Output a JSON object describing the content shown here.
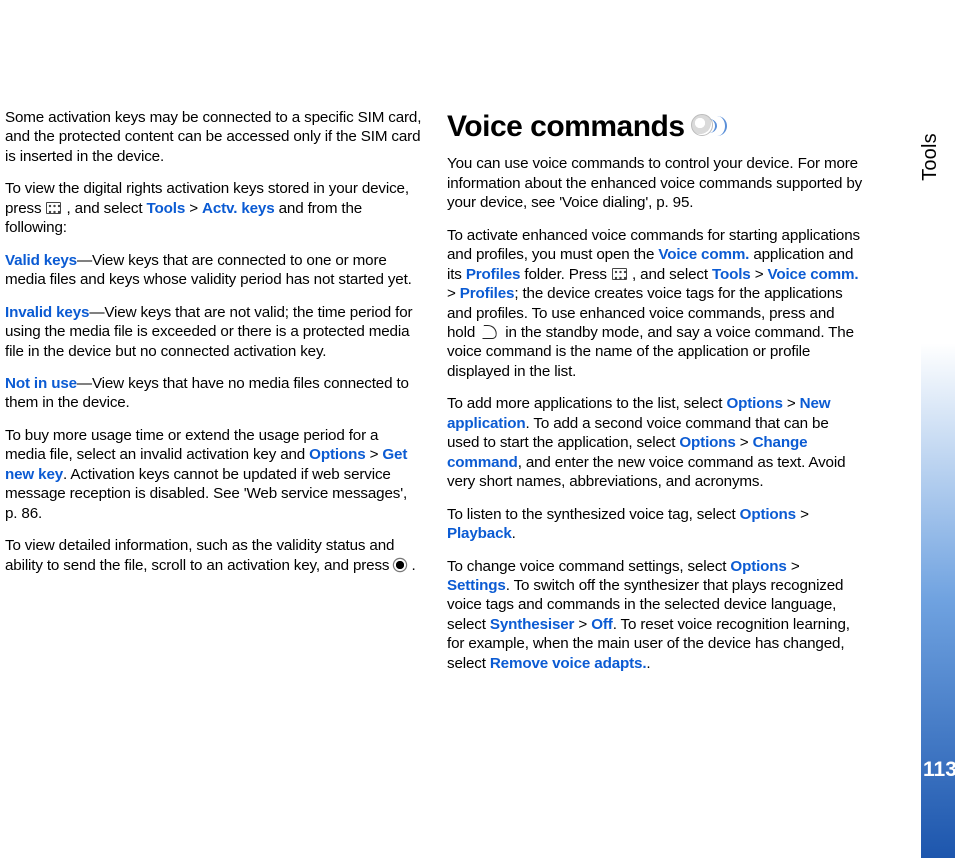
{
  "sideLabel": "Tools",
  "pageNumber": "113",
  "left": {
    "p1": "Some activation keys may be connected to a specific SIM card, and the protected content can be accessed only if the SIM card is inserted in the device.",
    "p2a": "To view the digital rights activation keys stored in your device, press ",
    "p2b": " , and select ",
    "tools": "Tools",
    "gt": " > ",
    "actvKeys": "Actv. keys",
    "p2c": " and from the following:",
    "validKeys": "Valid keys",
    "p3": "—View keys that are connected to one or more media files and keys whose validity period has not started yet.",
    "invalidKeys": "Invalid keys",
    "p4": "—View keys that are not valid; the time period for using the media file is exceeded or there is a protected media file in the device but no connected activation key.",
    "notInUse": "Not in use",
    "p5": "—View keys that have no media files connected to them in the device.",
    "p6a": "To buy more usage time or extend the usage period for a media file, select an invalid activation key and ",
    "options": "Options",
    "getNewKey": "Get new key",
    "p6b": ". Activation keys cannot be updated if web service message reception is disabled. See 'Web service messages', p. 86.",
    "p7a": "To view detailed information, such as the validity status and ability to send the file, scroll to an activation key, and press ",
    "p7b": " ."
  },
  "right": {
    "heading": "Voice commands",
    "p1": "You can use voice commands to control your device. For more information about the enhanced voice commands supported by your device, see 'Voice dialing', p. 95.",
    "p2a": "To activate enhanced voice commands for starting applications and profiles, you must open the ",
    "voiceComm": "Voice comm.",
    "p2b": " application and its ",
    "profiles": "Profiles",
    "p2c": " folder. Press ",
    "p2d": " , and select ",
    "tools": "Tools",
    "gt": " > ",
    "p2e": "; the device creates voice tags for the applications and profiles. To use enhanced voice commands, press and hold ",
    "p2f": " in the standby mode, and say a voice command. The voice command is the name of the application or profile displayed in the list.",
    "p3a": "To add more applications to the list, select ",
    "options": "Options",
    "newApp": "New application",
    "p3b": ". To add a second voice command that can be used to start the application, select ",
    "changeCmd": "Change command",
    "p3c": ", and enter the new voice command as text. Avoid very short names, abbreviations, and acronyms.",
    "p4a": "To listen to the synthesized voice tag, select ",
    "playback": "Playback",
    "dot": ".",
    "p5a": "To change voice command settings, select ",
    "settings": "Settings",
    "p5b": ". To switch off the synthesizer that plays recognized voice tags and commands in the selected device language, select ",
    "synthesiser": "Synthesiser",
    "off": "Off",
    "p5c": ". To reset voice recognition learning, for example, when the main user of the device has changed, select ",
    "removeAdapts": "Remove voice adapts.",
    "p5d": "."
  }
}
